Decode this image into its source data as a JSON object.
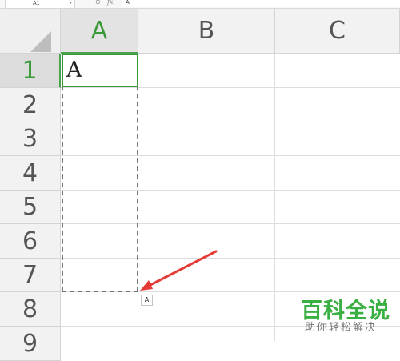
{
  "formula_bar": {
    "name_box": "A1",
    "name_box_dropdown": "▾",
    "zoom_icon": "⊕",
    "fx_label": "fx",
    "content": "A"
  },
  "columns": [
    "A",
    "B",
    "C"
  ],
  "rows": [
    "1",
    "2",
    "3",
    "4",
    "5",
    "6",
    "7",
    "8",
    "9"
  ],
  "active_column": "A",
  "active_row": "1",
  "cells": {
    "A1": "A"
  },
  "paste_options_badge": "A",
  "watermark": {
    "title": "百科全说",
    "subtitle": "助你轻松解决"
  },
  "colors": {
    "accent_green": "#3a9a3a",
    "arrow_red": "#e53935",
    "watermark_green": "#3ab043"
  }
}
